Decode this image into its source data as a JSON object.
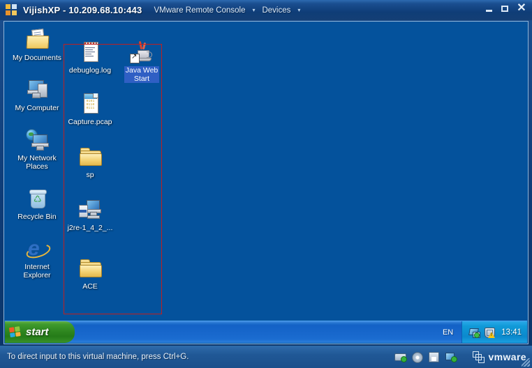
{
  "window": {
    "title": "VijishXP - 10.209.68.10:443",
    "app_icon": "vmware-console-icon",
    "menus": [
      {
        "label": "VMware Remote Console",
        "caret": "▾"
      },
      {
        "label": "Devices",
        "caret": "▾"
      }
    ],
    "controls": {
      "minimize": "minimize-button",
      "maximize": "maximize-button",
      "close": "✕"
    }
  },
  "desktop": {
    "background_color": "#04529c",
    "icons_column_left": [
      {
        "label": "My Documents",
        "icon": "my-documents-icon",
        "selected": false
      },
      {
        "label": "My Computer",
        "icon": "my-computer-icon",
        "selected": false
      },
      {
        "label": "My Network\nPlaces",
        "icon": "my-network-places-icon",
        "selected": false
      },
      {
        "label": "Recycle Bin",
        "icon": "recycle-bin-icon",
        "selected": false
      },
      {
        "label": "Internet\nExplorer",
        "icon": "internet-explorer-icon",
        "selected": false
      }
    ],
    "icons_column_middle": [
      {
        "label": "debuglog.log",
        "icon": "text-file-icon",
        "selected": false
      },
      {
        "label": "Capture.pcap",
        "icon": "binary-file-icon",
        "selected": false
      },
      {
        "label": "sp",
        "icon": "folder-icon",
        "selected": false
      },
      {
        "label": "j2re-1_4_2_...",
        "icon": "installer-icon",
        "selected": false
      },
      {
        "label": "ACE",
        "icon": "folder-icon",
        "selected": false
      }
    ],
    "icons_column_right": [
      {
        "label": "Java Web\nStart",
        "icon": "java-web-start-icon",
        "selected": true,
        "shortcut": true
      }
    ],
    "annotation": {
      "type": "rectangle",
      "color": "#c02020"
    },
    "binary_sample": "0101\n0110\n0111"
  },
  "taskbar": {
    "start_label": "start",
    "start_icon": "windows-flag-icon",
    "language": "EN",
    "clock": "13:41",
    "tray_icons": [
      {
        "name": "network-connection-icon"
      },
      {
        "name": "security-alert-shield-icon"
      }
    ]
  },
  "statusbar": {
    "message": "To direct input to this virtual machine, press Ctrl+G.",
    "devices": [
      {
        "name": "hard-disk-icon"
      },
      {
        "name": "cd-rom-icon"
      },
      {
        "name": "floppy-disk-icon"
      },
      {
        "name": "network-adapter-icon"
      }
    ],
    "brand": "vmware"
  }
}
